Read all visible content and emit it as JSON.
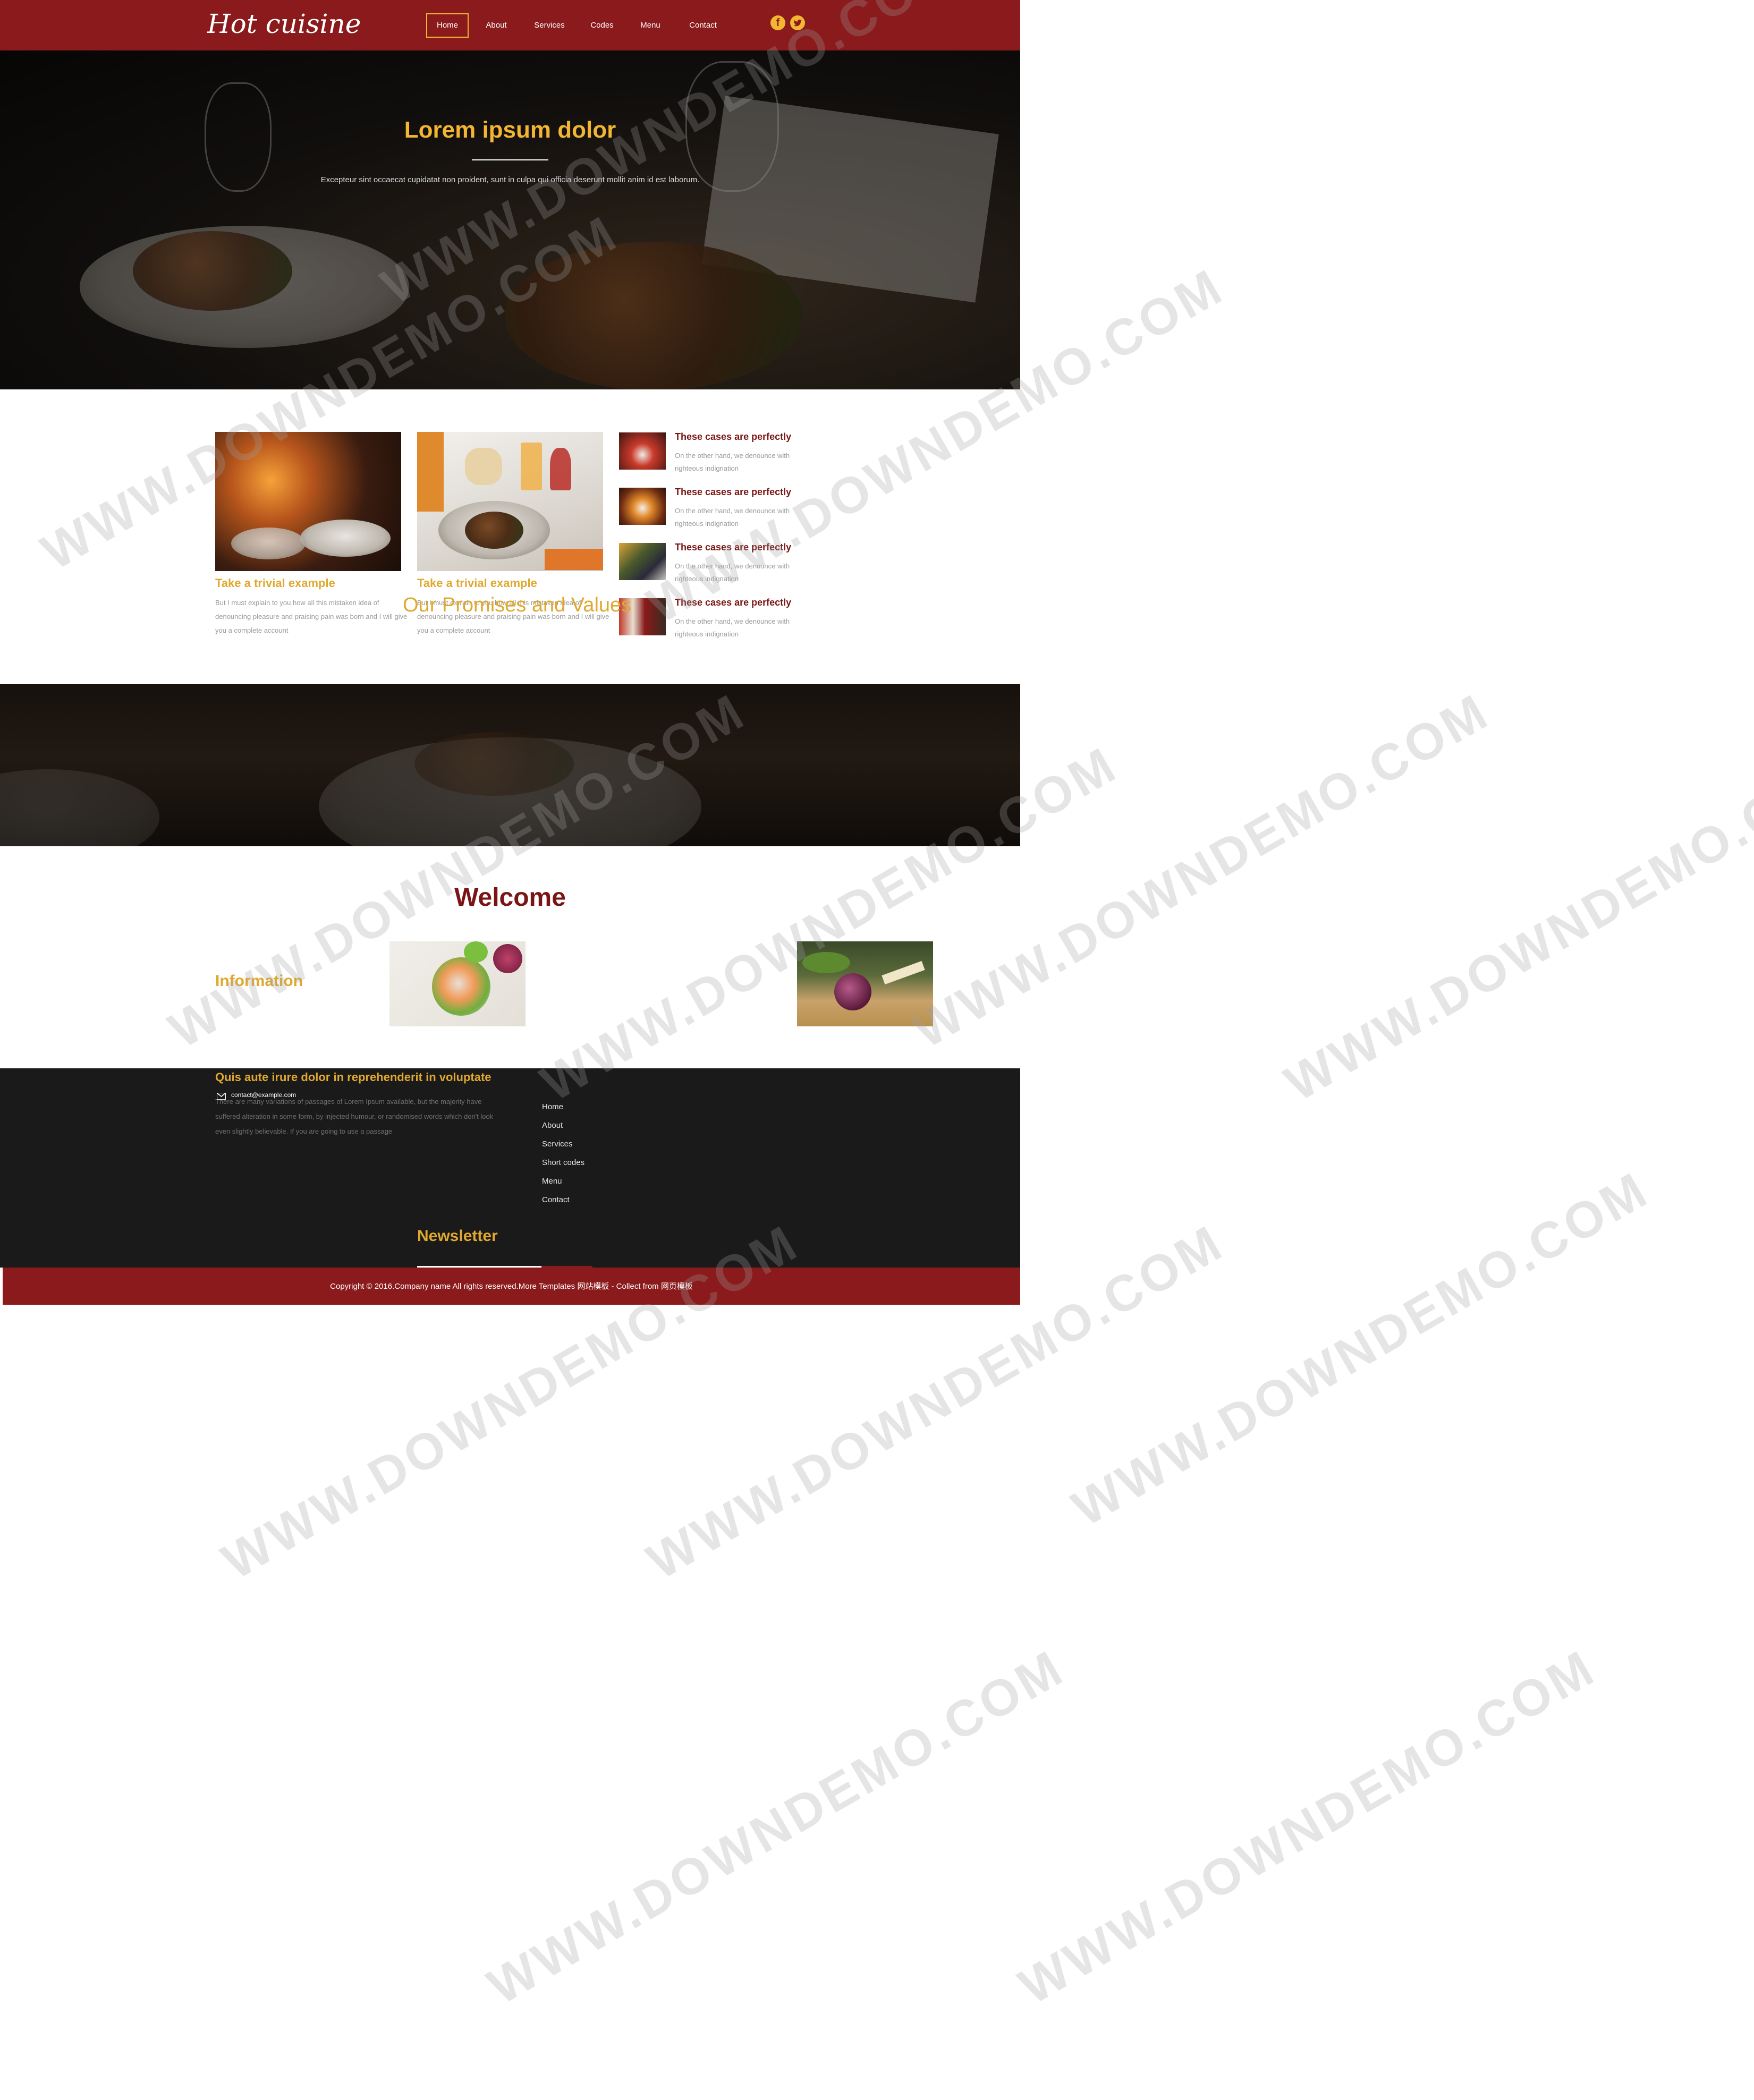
{
  "header": {
    "logo": "Hot cuisine",
    "nav": [
      "Home",
      "About",
      "Services",
      "Codes",
      "Menu",
      "Contact"
    ],
    "social": [
      "facebook-icon",
      "twitter-icon"
    ],
    "colors": {
      "brand": "#8a1a1b",
      "accent": "#f2b632"
    }
  },
  "hero": {
    "title": "Lorem ipsum dolor",
    "text": "Excepteur sint occaecat cupidatat non proident, sunt in culpa qui officia deserunt mollit anim id est laborum."
  },
  "features": {
    "cards": [
      {
        "title": "Take a trivial example",
        "text": "But I must explain to you how all this mistaken idea of denouncing pleasure and praising pain was born and I will give you a complete account"
      },
      {
        "title": "Take a trivial example",
        "text": "But I must explain to you how all this mistaken idea of denouncing pleasure and praising pain was born and I will give you a complete account"
      }
    ],
    "side_items": [
      {
        "title": "These cases are perfectly",
        "text": "On the other hand, we denounce with righteous indignation"
      },
      {
        "title": "These cases are perfectly",
        "text": "On the other hand, we denounce with righteous indignation"
      },
      {
        "title": "These cases are perfectly",
        "text": "On the other hand, we denounce with righteous indignation"
      },
      {
        "title": "These cases are perfectly",
        "text": "On the other hand, we denounce with righteous indignation"
      }
    ],
    "promises_heading": "Our Promises and Values"
  },
  "welcome": {
    "title": "Welcome",
    "info_heading": "Information"
  },
  "footer": {
    "heading": "Quis aute irure dolor in reprehenderit in voluptate",
    "text": "There are many variations of passages of Lorem Ipsum available, but the majority have suffered alteration in some form, by injected humour, or randomised words which don't look even slightly believable. If you are going to use a passage",
    "email": "contact@example.com",
    "links": [
      "Home",
      "About",
      "Services",
      "Short codes",
      "Menu",
      "Contact"
    ],
    "newsletter_heading": "Newsletter"
  },
  "copyright": "Copyright © 2016.Company name All rights reserved.More Templates 网站模板 - Collect from 网页模板",
  "watermark": "WWW.DOWNDEMO.COM"
}
